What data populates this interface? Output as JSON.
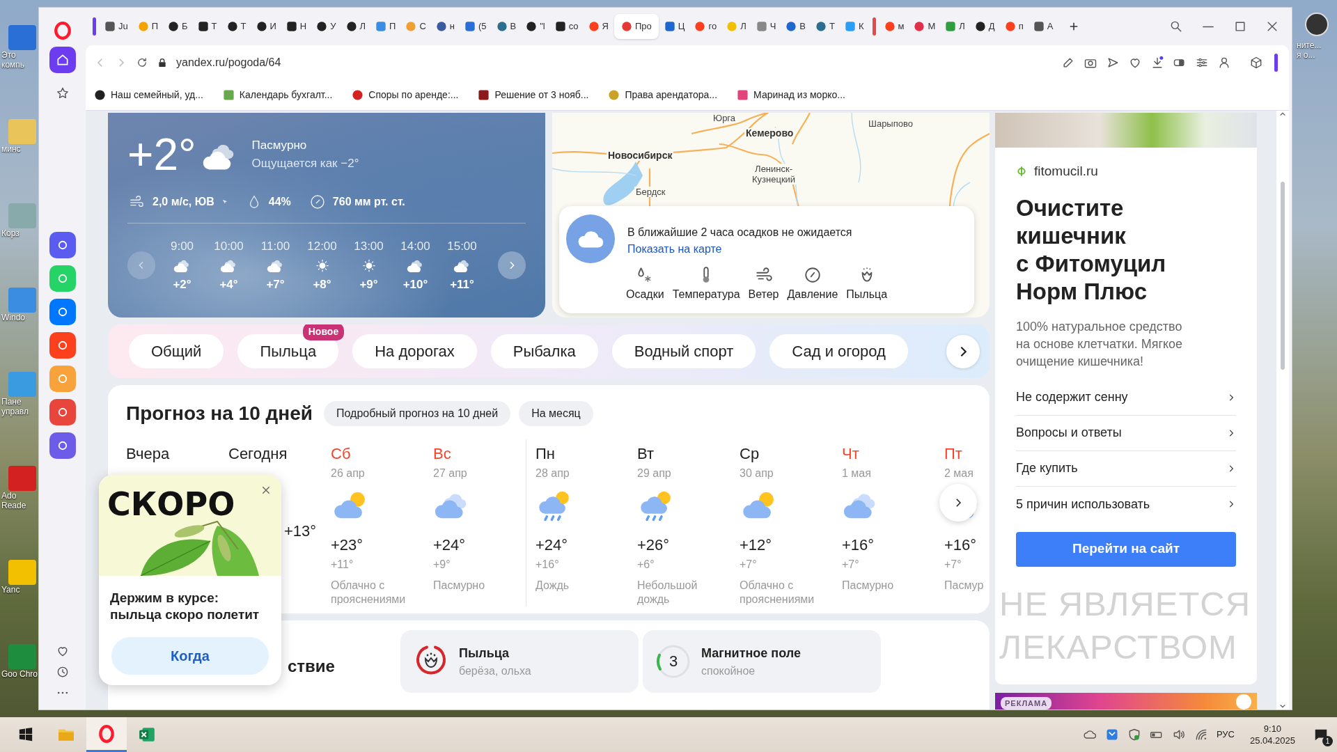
{
  "desktop": {
    "left_icons": [
      "Это компь",
      "минс",
      "Корз",
      "Windo",
      "Пане управл",
      "Ado Reade",
      "Yanc",
      "Goo Chro"
    ],
    "right_icons": [
      "ните...",
      "я о..."
    ]
  },
  "browser": {
    "tabs": [
      {
        "label": "Ju",
        "selected": false
      },
      {
        "label": "П",
        "selected": false
      },
      {
        "label": "Б",
        "selected": false
      },
      {
        "label": "Т",
        "selected": false
      },
      {
        "label": "Т",
        "selected": false
      },
      {
        "label": "И",
        "selected": false
      },
      {
        "label": "Н",
        "selected": false
      },
      {
        "label": "У",
        "selected": false
      },
      {
        "label": "Л",
        "selected": false
      },
      {
        "label": "П",
        "selected": false
      },
      {
        "label": "С",
        "selected": false
      },
      {
        "label": "н",
        "selected": false
      },
      {
        "label": "(5",
        "selected": false
      },
      {
        "label": "В",
        "selected": false
      },
      {
        "label": "\"l",
        "selected": false
      },
      {
        "label": "со",
        "selected": false
      },
      {
        "label": "Я",
        "selected": false
      },
      {
        "label": "Про",
        "selected": true
      },
      {
        "label": "Ц",
        "selected": false
      },
      {
        "label": "го",
        "selected": false
      },
      {
        "label": "Л",
        "selected": false
      },
      {
        "label": "Ч",
        "selected": false
      },
      {
        "label": "В",
        "selected": false
      },
      {
        "label": "Т",
        "selected": false
      },
      {
        "label": "К",
        "selected": false
      },
      {
        "label": "м",
        "selected": false
      },
      {
        "label": "М",
        "selected": false
      },
      {
        "label": "Л",
        "selected": false
      },
      {
        "label": "Д",
        "selected": false
      },
      {
        "label": "п",
        "selected": false
      },
      {
        "label": "А",
        "selected": false
      }
    ],
    "url": "yandex.ru/pogoda/64",
    "bookmarks": [
      "Наш семейный, уд...",
      "Календарь бухгалт...",
      "Споры по аренде:...",
      "Решение от 3 нояб...",
      "Права арендатора...",
      "Маринад из морко..."
    ]
  },
  "current": {
    "temp": "+2°",
    "condition": "Пасмурно",
    "feels_like": "Ощущается как −2°",
    "wind": "2,0 м/с, ЮВ",
    "humidity": "44%",
    "pressure": "760 мм рт. ст.",
    "hours": [
      {
        "time": "9:00",
        "kind": "cloudy",
        "temp": "+2°"
      },
      {
        "time": "10:00",
        "kind": "cloudy",
        "temp": "+4°"
      },
      {
        "time": "11:00",
        "kind": "cloudy",
        "temp": "+7°"
      },
      {
        "time": "12:00",
        "kind": "sun",
        "temp": "+8°"
      },
      {
        "time": "13:00",
        "kind": "sun",
        "temp": "+9°"
      },
      {
        "time": "14:00",
        "kind": "cloudy",
        "temp": "+10°"
      },
      {
        "time": "15:00",
        "kind": "cloudy",
        "temp": "+11°"
      }
    ]
  },
  "map": {
    "labels": [
      {
        "text": "Юрга",
        "major": false
      },
      {
        "text": "Кемерово",
        "major": true
      },
      {
        "text": "Шарыпово",
        "major": false
      },
      {
        "text": "Новосибирск",
        "major": true
      },
      {
        "text": "Ленинск-\nКузнецкий",
        "major": false
      },
      {
        "text": "Бердск",
        "major": false
      }
    ],
    "nowcast": {
      "text": "В ближайшие 2 часа осадков не ожидается",
      "link": "Показать на карте",
      "layers": [
        {
          "kind": "precipitation",
          "label": "Осадки"
        },
        {
          "kind": "temperature",
          "label": "Температура"
        },
        {
          "kind": "wind",
          "label": "Ветер"
        },
        {
          "kind": "pressure",
          "label": "Давление"
        },
        {
          "kind": "pollen",
          "label": "Пыльца"
        }
      ]
    }
  },
  "categories": [
    {
      "label": "Общий"
    },
    {
      "label": "Пыльца",
      "badge": "Новое"
    },
    {
      "label": "На дорогах"
    },
    {
      "label": "Рыбалка"
    },
    {
      "label": "Водный спорт"
    },
    {
      "label": "Сад и огород"
    }
  ],
  "forecast": {
    "title": "Прогноз на 10 дней",
    "links": [
      "Подробный прогноз на 10 дней",
      "На месяц"
    ],
    "days": [
      {
        "name": "Вчера",
        "holiday": false,
        "new_week": false
      },
      {
        "name": "Сегодня",
        "holiday": false,
        "new_week": false,
        "high": "+13°"
      },
      {
        "name": "Сб",
        "date": "26 апр",
        "holiday": true,
        "new_week": false,
        "kind": "cloud_sun",
        "high": "+23°",
        "low": "+11°",
        "condition": "Облачно с прояснениями"
      },
      {
        "name": "Вс",
        "date": "27 апр",
        "holiday": true,
        "new_week": false,
        "kind": "cloud",
        "high": "+24°",
        "low": "+9°",
        "condition": "Пасмурно"
      },
      {
        "name": "Пн",
        "date": "28 апр",
        "holiday": false,
        "new_week": true,
        "kind": "rain_sun",
        "high": "+24°",
        "low": "+16°",
        "condition": "Дождь"
      },
      {
        "name": "Вт",
        "date": "29 апр",
        "holiday": false,
        "new_week": false,
        "kind": "rain_sun",
        "high": "+26°",
        "low": "+6°",
        "condition": "Небольшой дождь"
      },
      {
        "name": "Ср",
        "date": "30 апр",
        "holiday": false,
        "new_week": false,
        "kind": "cloud_sun",
        "high": "+12°",
        "low": "+7°",
        "condition": "Облачно с прояснениями"
      },
      {
        "name": "Чт",
        "date": "1 мая",
        "holiday": true,
        "new_week": false,
        "kind": "cloud",
        "high": "+16°",
        "low": "+7°",
        "condition": "Пасмурно"
      },
      {
        "name": "Пт",
        "date": "2 мая",
        "holiday": true,
        "new_week": false,
        "kind": "cloud",
        "high": "+16°",
        "low": "+7°",
        "condition": "Пасмур"
      }
    ]
  },
  "promo": {
    "title": "СКОРО",
    "text": "Держим в курсе:\nпыльца скоро полетит",
    "button": "Когда"
  },
  "bottom": {
    "section_tail": "ствие",
    "pollen": {
      "title": "Пыльца",
      "subtitle": "берёза, ольха"
    },
    "magnetic": {
      "value": "3",
      "title": "Магнитное поле",
      "subtitle": "спокойное",
      "level": 0.15
    }
  },
  "ad": {
    "domain": "fitomucil.ru",
    "title": "Очистите\nкишечник\nс Фитомуцил\nНорм Плюс",
    "description": "100% натуральное средство\nна основе клетчатки. Мягкое\nочищение кишечника!",
    "links": [
      "Не содержит сенну",
      "Вопросы и ответы",
      "Где купить",
      "5 причин использовать"
    ],
    "button": "Перейти на сайт",
    "disclaimer": "НЕ ЯВЛЯЕТСЯ\nЛЕКАРСТВОМ",
    "label": "РЕКЛАМА"
  },
  "taskbar": {
    "apps": [
      {
        "kind": "explorer",
        "active": false
      },
      {
        "kind": "opera",
        "active": true
      },
      {
        "kind": "excel",
        "active": false
      }
    ],
    "language": "РУС",
    "time": "9:10",
    "date": "25.04.2025",
    "notifications": "1"
  }
}
